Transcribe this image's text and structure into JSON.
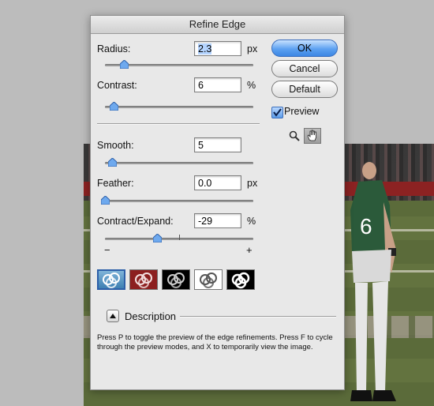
{
  "dialog": {
    "title": "Refine Edge",
    "radius": {
      "label": "Radius:",
      "value": "2.3",
      "unit": "px",
      "slider_fraction": 0.13
    },
    "contrast": {
      "label": "Contrast:",
      "value": "6",
      "unit": "%",
      "slider_fraction": 0.06
    },
    "smooth": {
      "label": "Smooth:",
      "value": "5",
      "slider_fraction": 0.05
    },
    "feather": {
      "label": "Feather:",
      "value": "0.0",
      "unit": "px",
      "slider_fraction": 0.0
    },
    "contract_expand": {
      "label": "Contract/Expand:",
      "value": "-29",
      "unit": "%",
      "slider_fraction": 0.355,
      "minus_label": "−",
      "plus_label": "+"
    },
    "buttons": {
      "ok": "OK",
      "cancel": "Cancel",
      "default": "Default"
    },
    "preview": {
      "label": "Preview",
      "checked": true
    },
    "tools": [
      "zoom-tool",
      "hand-tool"
    ],
    "preview_modes": [
      "standard-mode",
      "quick-mask-mode",
      "on-black-mode",
      "on-white-mode",
      "mask-mode"
    ],
    "description": {
      "label": "Description",
      "text": "Press P to toggle the preview of the edge refinements. Press F to cycle through the preview modes, and X to temporarily view the image."
    }
  },
  "colors": {
    "accent": "#3c86e3",
    "quick_mask": "#8c1f1f",
    "dialog_bg": "#e8e8e8"
  }
}
